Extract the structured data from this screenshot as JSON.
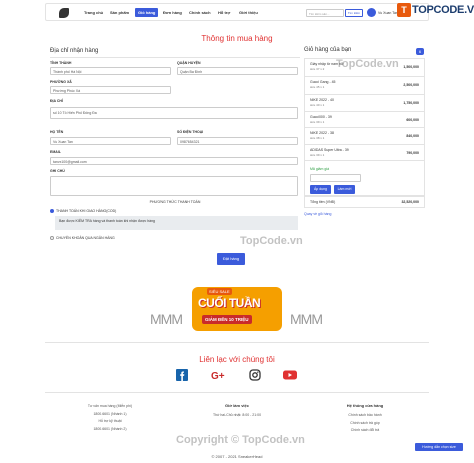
{
  "nav": {
    "items": [
      "Trang chủ",
      "Sản phẩm",
      "Giỏ hàng",
      "Đơn hàng",
      "Chính sách",
      "Hỗ trợ",
      "Giới thiệu"
    ],
    "search_placeholder": "Tìm kiếm sản...",
    "search_button": "Tìm kiếm",
    "user_name": "Vu Xuan Tan"
  },
  "brand": {
    "box": "T",
    "text": "TOPCODE.VN"
  },
  "page_title": "Thông tin mua hàng",
  "address": {
    "section_title": "Địa chỉ nhận hàng",
    "province_label": "TỈNH THÀNH",
    "province_value": "Thành phố Hà Nội",
    "district_label": "QUẬN HUYỆN",
    "district_value": "Quận Ba Đình",
    "ward_label": "PHƯỜNG XÃ",
    "ward_value": "Phường Phúc Xá",
    "street_label": "ĐỊA CHỈ",
    "street_value": "số 10 Tô Hiến Phố Đống Đa",
    "name_label": "HỌ TÊN",
    "name_value": "Vu Xuan Tan",
    "phone_label": "SỐ ĐIỆN THOẠI",
    "phone_value": "0987654321",
    "email_label": "EMAIL",
    "email_value": "tanvx100@gmail.com",
    "note_label": "GHI CHÚ"
  },
  "payment": {
    "title": "PHƯƠNG THỨC THANH TOÁN",
    "option1": "THANH TOÁN KHI GIAO HÀNG(COD)",
    "option1_note": "Bạn được KIỂM TRA hàng và thanh toán khi nhận được hàng",
    "option2": "CHUYỂN KHOẢN QUA NGÂN HÀNG",
    "order_button": "Đặt hàng"
  },
  "cart": {
    "title": "Giỏ hàng của bạn",
    "count": "6",
    "items": [
      {
        "name": "Giày nhập từ nam nữ",
        "sub": "size 37 x 2",
        "price": "1,500,000"
      },
      {
        "name": "Gucci Gang - 45",
        "sub": "size 45 x 1",
        "price": "2,500,000"
      },
      {
        "name": "NIKE 2022 - 40",
        "sub": "size 40 x 1",
        "price": "1,750,000"
      },
      {
        "name": "Gucci000 - 39",
        "sub": "size 39 x 1",
        "price": "600,000"
      },
      {
        "name": "NIKE 2022 - 38",
        "sub": "size 38 x 1",
        "price": "840,000"
      },
      {
        "name": "ADIDAS Super Ultra - 39",
        "sub": "size 39 x 1",
        "price": "790,000"
      }
    ],
    "promo_label": "Mã giảm giá",
    "apply_button": "Áp dụng",
    "remove_button": "Làm mới",
    "total_label": "Tổng tiền (VNĐ)",
    "total_value": "32,520,000",
    "continue_link": "Quay về giỏ hàng"
  },
  "watermarks": [
    "TopCode.vn",
    "TopCode.vn",
    "Copyright © TopCode.vn"
  ],
  "banner": {
    "tag": "SIÊU SALE",
    "main": "CUỐI TUẦN",
    "sub": "GIẢM ĐẾN 10 TRIỆU",
    "deco_left": "MMM",
    "deco_right": "MMM"
  },
  "contact_title": "Liên lạc với chúng tôi",
  "social_icons": [
    "facebook-icon",
    "google-plus-icon",
    "instagram-icon",
    "youtube-icon"
  ],
  "footer": {
    "col1": [
      "Tư vấn mua hàng (Miễn phí)",
      "1800.6601 (Nhánh 1)",
      "Hỗ trợ kỹ thuật",
      "1800.6601 (Nhánh 2)"
    ],
    "col2_title": "Giờ làm việc",
    "col2": [
      "Thứ hai-Chủ nhật: 8:00 - 21:00"
    ],
    "col3_title": "Hệ thống cửa hàng",
    "col3": [
      "Chính sách bảo hành",
      "Chính sách trả góp",
      "Chính sách đổi trả"
    ],
    "copyright": "© 2007 - 2021 SneakerHead",
    "chat_button": "Hướng dẫn chọn size"
  }
}
